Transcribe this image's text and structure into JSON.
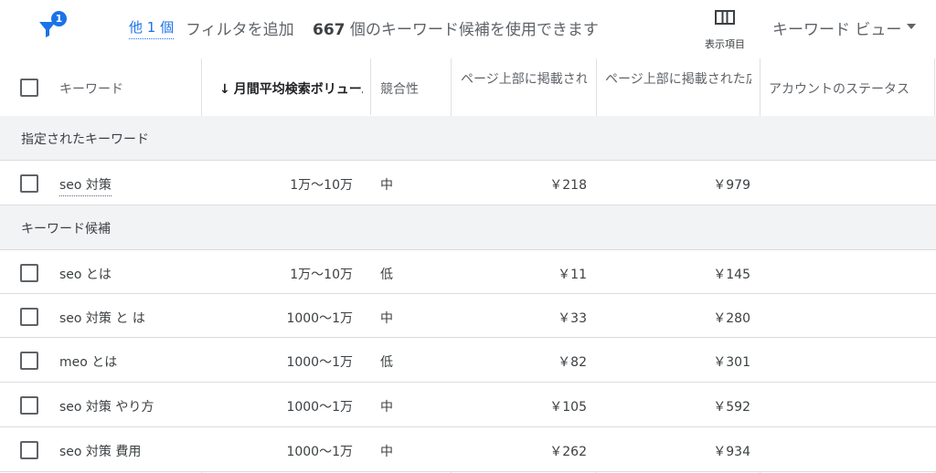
{
  "toolbar": {
    "filter_badge": "1",
    "more_filters_link": "他 1 個",
    "add_filter_label": "フィルタを追加",
    "count_number": "667",
    "count_suffix": " 個のキーワード候補を使用できます",
    "columns_label": "表示項目",
    "view_select_value": "キーワード ビュー"
  },
  "table": {
    "headers": {
      "keyword": "キーワード",
      "sort_arrow": "↓",
      "avg_monthly_searches": "月間平均検索ボリューム",
      "competition": "競合性",
      "top_bid_low": "ページ上部に掲載された広告の入札単価（低額帯）",
      "top_bid_high": "ページ上部に掲載された広告の入札単価（高額帯）",
      "account_status": "アカウントのステータス"
    },
    "groups": [
      {
        "label": "指定されたキーワード",
        "rows": [
          {
            "keyword": "seo 対策",
            "volume": "1万～10万",
            "competition": "中",
            "bid_low": "￥218",
            "bid_high": "￥979"
          }
        ]
      },
      {
        "label": "キーワード候補",
        "rows": [
          {
            "keyword": "seo とは",
            "volume": "1万～10万",
            "competition": "低",
            "bid_low": "￥11",
            "bid_high": "￥145"
          },
          {
            "keyword": "seo 対策 と は",
            "volume": "1000～1万",
            "competition": "中",
            "bid_low": "￥33",
            "bid_high": "￥280"
          },
          {
            "keyword": "meo とは",
            "volume": "1000～1万",
            "competition": "低",
            "bid_low": "￥82",
            "bid_high": "￥301"
          },
          {
            "keyword": "seo 対策 やり方",
            "volume": "1000～1万",
            "competition": "中",
            "bid_low": "￥105",
            "bid_high": "￥592"
          },
          {
            "keyword": "seo 対策 費用",
            "volume": "1000～1万",
            "competition": "中",
            "bid_low": "￥262",
            "bid_high": "￥934"
          }
        ]
      }
    ]
  },
  "colors": {
    "accent": "#1a73e8",
    "group_background": "#f1f3f4",
    "text": "#3c4043"
  },
  "icons": {
    "filter": "filter-icon",
    "columns": "columns-icon",
    "dropdown": "caret-down-icon"
  }
}
